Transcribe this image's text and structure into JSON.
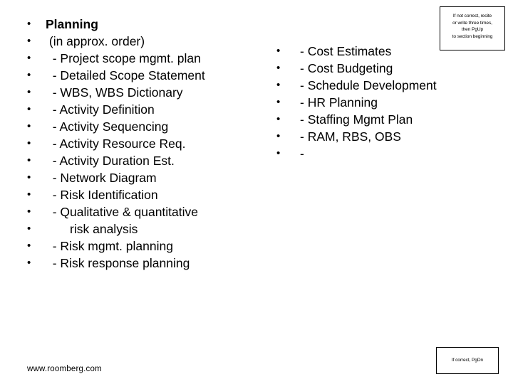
{
  "slide": {
    "title": "Planning",
    "left_column": [
      {
        "bullet": "•",
        "text": "Planning",
        "bold": true
      },
      {
        "bullet": "•",
        "text": " (in approx. order)",
        "bold": false
      },
      {
        "bullet": "•",
        "text": "  - Project scope mgmt. plan",
        "bold": false
      },
      {
        "bullet": "•",
        "text": "  - Detailed Scope Statement",
        "bold": false
      },
      {
        "bullet": "•",
        "text": "  - WBS, WBS Dictionary",
        "bold": false
      },
      {
        "bullet": "•",
        "text": "  - Activity Definition",
        "bold": false
      },
      {
        "bullet": "•",
        "text": "  - Activity Sequencing",
        "bold": false
      },
      {
        "bullet": "•",
        "text": "  - Activity Resource Req.",
        "bold": false
      },
      {
        "bullet": "•",
        "text": "  - Activity Duration Est.",
        "bold": false
      },
      {
        "bullet": "•",
        "text": "  - Network Diagram",
        "bold": false
      },
      {
        "bullet": "•",
        "text": "  - Risk Identification",
        "bold": false
      },
      {
        "bullet": "•",
        "text": "  - Qualitative & quantitative",
        "bold": false
      },
      {
        "bullet": "•",
        "text": "       risk analysis",
        "bold": false
      },
      {
        "bullet": "•",
        "text": "  - Risk mgmt. planning",
        "bold": false
      },
      {
        "bullet": "•",
        "text": "  - Risk response planning",
        "bold": false
      }
    ],
    "right_column": [
      {
        "bullet": "•",
        "text": "- Cost Estimates"
      },
      {
        "bullet": "•",
        "text": "- Cost Budgeting"
      },
      {
        "bullet": "•",
        "text": "- Schedule Development"
      },
      {
        "bullet": "•",
        "text": "- HR Planning"
      },
      {
        "bullet": "•",
        "text": "- Staffing Mgmt Plan"
      },
      {
        "bullet": "•",
        "text": "- RAM, RBS, OBS"
      },
      {
        "bullet": "•",
        "text": "-"
      }
    ],
    "footer_url": "www.roomberg.com",
    "note_top": {
      "lines": [
        "If not correct, recite",
        "or write three times,",
        "then PgUp",
        "to section beginning"
      ]
    },
    "note_bottom": {
      "lines": [
        "If correct, PgDn"
      ]
    }
  },
  "colors": {
    "background": "#ffffff",
    "text": "#000000",
    "box_border": "#000000"
  }
}
